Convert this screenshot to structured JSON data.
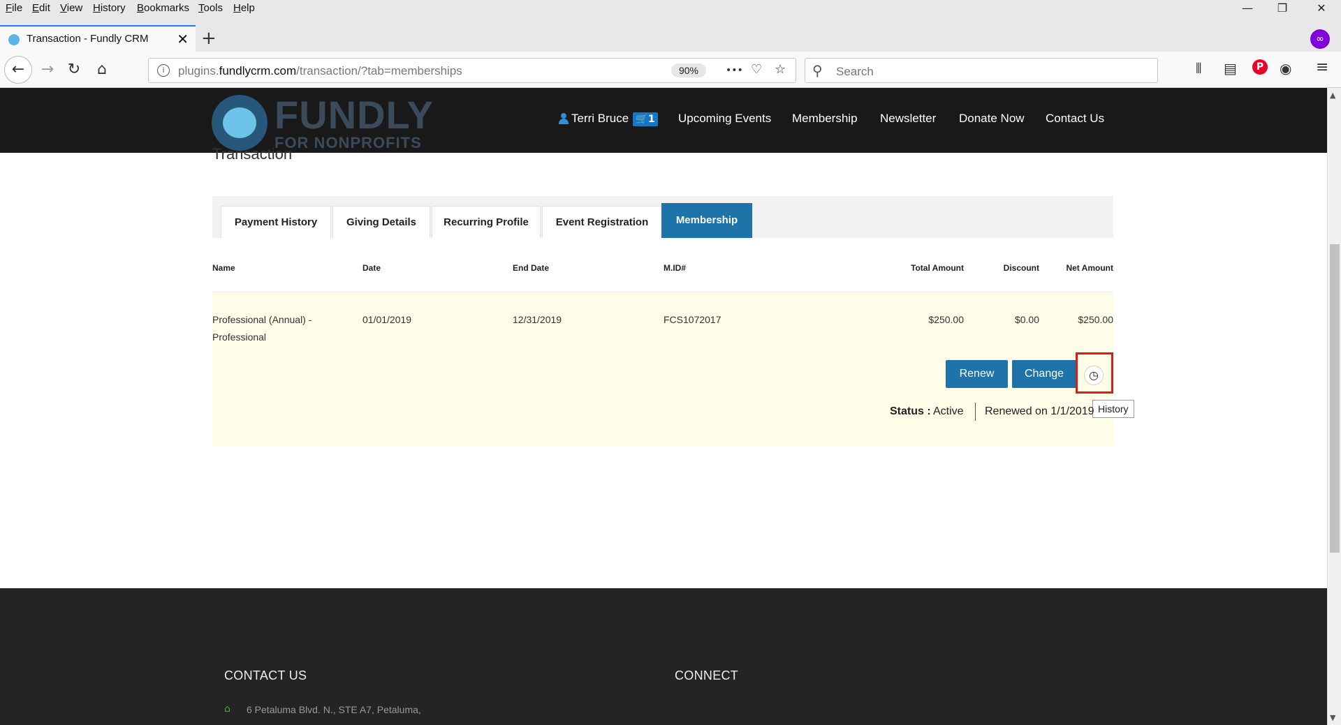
{
  "browser": {
    "menu": [
      "File",
      "Edit",
      "View",
      "History",
      "Bookmarks",
      "Tools",
      "Help"
    ],
    "window_controls": {
      "minimize": "—",
      "restore": "❐",
      "close": "✕"
    },
    "tab": {
      "title": "Transaction - Fundly CRM",
      "close": "✕"
    },
    "new_tab": "+",
    "private_badge": "∞",
    "url": {
      "prefix": "plugins.",
      "domain": "fundlycrm.com",
      "path": "/transaction/?tab=memberships"
    },
    "zoom": "90%",
    "page_actions": {
      "more": "•••",
      "pocket": "♡",
      "bookmark": "☆"
    },
    "search_placeholder": "Search",
    "toolbar_icons": {
      "library": "⫴",
      "sidebar": "▤",
      "pinterest": "P",
      "account": "◉",
      "menu": "≡"
    },
    "nav_icons": {
      "back": "←",
      "forward": "→",
      "reload": "↻",
      "home": "⌂"
    },
    "info_icon": "i",
    "search_icon": "⚲"
  },
  "site": {
    "logo": {
      "brand": "FUNDLY",
      "tagline": "FOR NONPROFITS"
    },
    "nav": {
      "user_name": "Terri Bruce",
      "cart_count": "🛒1",
      "items": [
        "Upcoming Events",
        "Membership",
        "Newsletter",
        "Donate Now",
        "Contact Us"
      ]
    }
  },
  "page": {
    "heading": "Transaction",
    "tabs": [
      "Payment History",
      "Giving Details",
      "Recurring Profile",
      "Event Registration",
      "Membership"
    ],
    "active_tab": "Membership",
    "columns": [
      "Name",
      "Date",
      "End Date",
      "M.ID#",
      "Total Amount",
      "Discount",
      "Net Amount"
    ],
    "row": {
      "name_line1": "Professional (Annual) -",
      "name_line2": "Professional",
      "date": "01/01/2019",
      "end_date": "12/31/2019",
      "mid": "FCS1072017",
      "total": "$250.00",
      "discount": "$0.00",
      "net": "$250.00"
    },
    "actions": {
      "renew": "Renew",
      "change": "Change",
      "history_icon": "◷",
      "history_tooltip": "History"
    },
    "status": {
      "label": "Status :",
      "value": "Active",
      "renewed": "Renewed on 1/1/2019"
    }
  },
  "footer": {
    "contact_heading": "CONTACT US",
    "connect_heading": "CONNECT",
    "address": "6 Petaluma Blvd. N., STE A7, Petaluma,",
    "home_icon": "⌂"
  },
  "colors": {
    "accent": "#1e73a8",
    "highlight": "#e01a1a",
    "row_bg": "#fefde8",
    "header_bg": "#191919"
  }
}
